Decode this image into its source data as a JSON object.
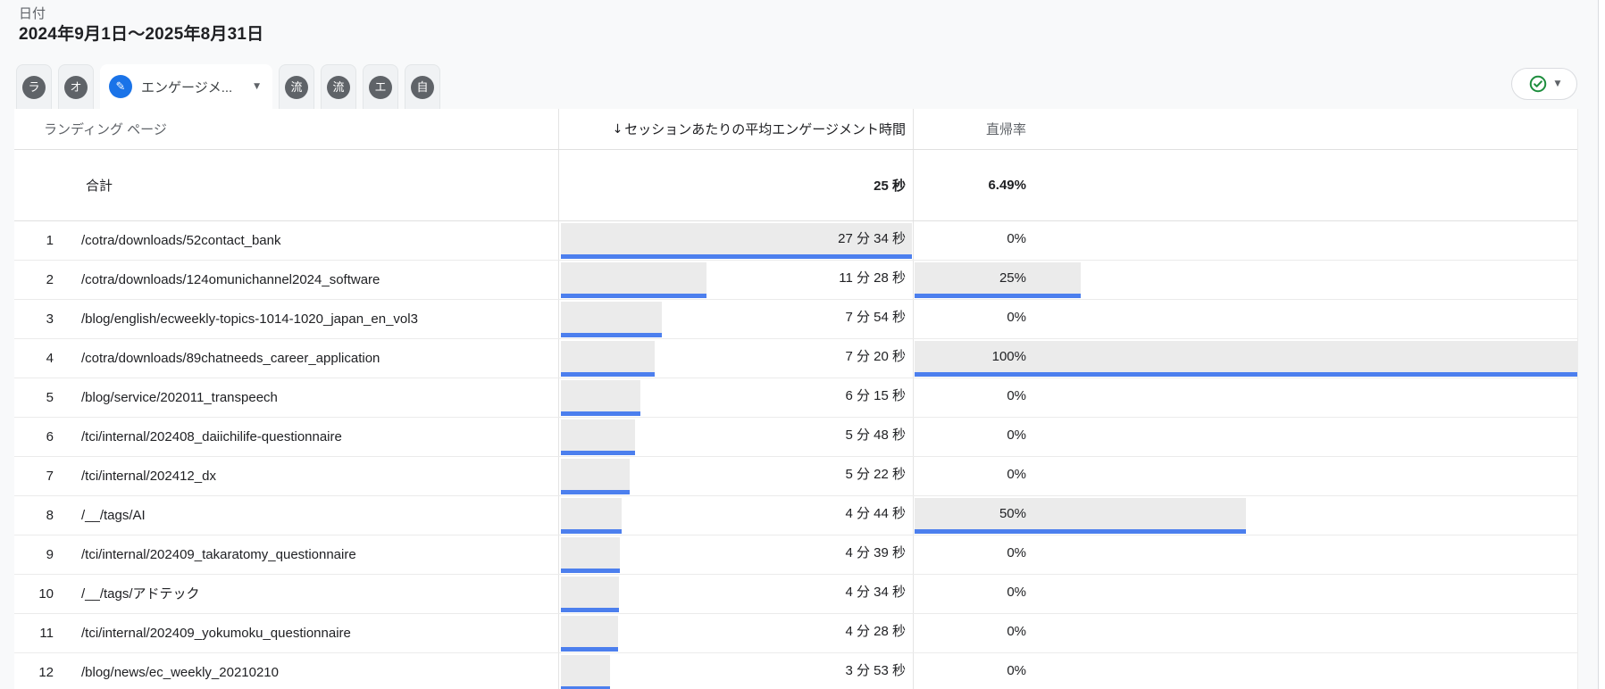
{
  "page": {
    "date_label": "日付",
    "date_range": "2024年9月1日～2025年8月31日"
  },
  "icons": {
    "caret_down": "▼",
    "sort_down": "↓",
    "pencil": "✎"
  },
  "colors": {
    "accent_blue": "#4c7fee",
    "bar_gray": "#ebebeb",
    "status_green": "#1e8e3e",
    "selected_tab_icon_blue": "#1a73e8"
  },
  "tabs": {
    "items": [
      {
        "label": "ラ",
        "selected": false
      },
      {
        "label": "オ",
        "selected": false
      },
      {
        "label": "エンゲージメ...",
        "selected": true
      },
      {
        "label": "流",
        "selected": false
      },
      {
        "label": "流",
        "selected": false
      },
      {
        "label": "エ",
        "selected": false
      },
      {
        "label": "自",
        "selected": false
      }
    ]
  },
  "table": {
    "columns": [
      {
        "label": "ランディング ページ",
        "sorted": false
      },
      {
        "label": "セッションあたりの平均エンゲージメント時間",
        "sorted": true
      },
      {
        "label": "直帰率",
        "sorted": false
      }
    ],
    "totals": {
      "label": "合計",
      "avg_engagement_time": "25 秒",
      "bounce_rate": "6.49%"
    },
    "rows": [
      {
        "rank": "1",
        "landing_page": "/cotra/downloads/52contact_bank",
        "avg_engagement_time": "27 分 34 秒",
        "time_bar_pct": 100,
        "bounce_rate": "0%",
        "bounce_bar_pct": 0
      },
      {
        "rank": "2",
        "landing_page": "/cotra/downloads/124omunichannel2024_software",
        "avg_engagement_time": "11 分 28 秒",
        "time_bar_pct": 41.6,
        "bounce_rate": "25%",
        "bounce_bar_pct": 25
      },
      {
        "rank": "3",
        "landing_page": "/blog/english/ecweekly-topics-1014-1020_japan_en_vol3",
        "avg_engagement_time": "7 分 54 秒",
        "time_bar_pct": 28.7,
        "bounce_rate": "0%",
        "bounce_bar_pct": 0
      },
      {
        "rank": "4",
        "landing_page": "/cotra/downloads/89chatneeds_career_application",
        "avg_engagement_time": "7 分 20 秒",
        "time_bar_pct": 26.6,
        "bounce_rate": "100%",
        "bounce_bar_pct": 100
      },
      {
        "rank": "5",
        "landing_page": "/blog/service/202011_transpeech",
        "avg_engagement_time": "6 分 15 秒",
        "time_bar_pct": 22.7,
        "bounce_rate": "0%",
        "bounce_bar_pct": 0
      },
      {
        "rank": "6",
        "landing_page": "/tci/internal/202408_daiichilife-questionnaire",
        "avg_engagement_time": "5 分 48 秒",
        "time_bar_pct": 21.0,
        "bounce_rate": "0%",
        "bounce_bar_pct": 0
      },
      {
        "rank": "7",
        "landing_page": "/tci/internal/202412_dx",
        "avg_engagement_time": "5 分 22 秒",
        "time_bar_pct": 19.5,
        "bounce_rate": "0%",
        "bounce_bar_pct": 0
      },
      {
        "rank": "8",
        "landing_page": "/__/tags/AI",
        "avg_engagement_time": "4 分 44 秒",
        "time_bar_pct": 17.2,
        "bounce_rate": "50%",
        "bounce_bar_pct": 50
      },
      {
        "rank": "9",
        "landing_page": "/tci/internal/202409_takaratomy_questionnaire",
        "avg_engagement_time": "4 分 39 秒",
        "time_bar_pct": 16.9,
        "bounce_rate": "0%",
        "bounce_bar_pct": 0
      },
      {
        "rank": "10",
        "landing_page": "/__/tags/アドテック",
        "avg_engagement_time": "4 分 34 秒",
        "time_bar_pct": 16.6,
        "bounce_rate": "0%",
        "bounce_bar_pct": 0
      },
      {
        "rank": "11",
        "landing_page": "/tci/internal/202409_yokumoku_questionnaire",
        "avg_engagement_time": "4 分 28 秒",
        "time_bar_pct": 16.2,
        "bounce_rate": "0%",
        "bounce_bar_pct": 0
      },
      {
        "rank": "12",
        "landing_page": "/blog/news/ec_weekly_20210210",
        "avg_engagement_time": "3 分 53 秒",
        "time_bar_pct": 14.1,
        "bounce_rate": "0%",
        "bounce_bar_pct": 0
      }
    ]
  }
}
